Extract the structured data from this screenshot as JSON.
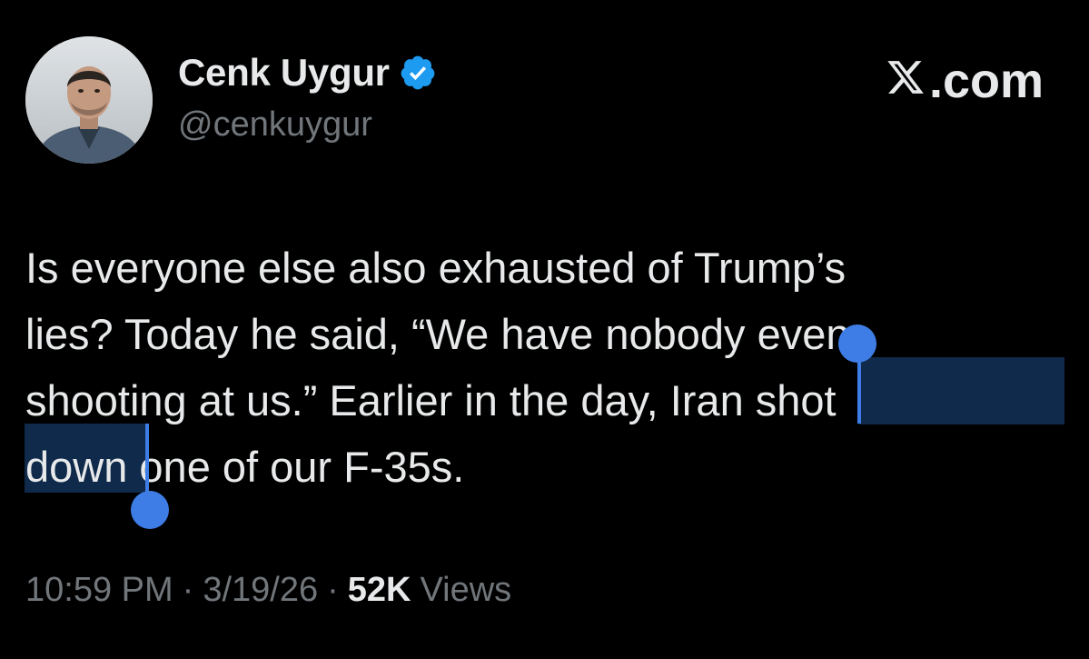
{
  "author": {
    "display_name": "Cenk Uygur",
    "handle": "@cenkuygur",
    "verified_icon": "verified-badge-icon",
    "avatar": "profile-photo"
  },
  "brand": {
    "logo_icon": "x-logo-icon",
    "suffix": ".com"
  },
  "tweet": {
    "lines": [
      "Is everyone else also exhausted of Trump’s",
      "lies? Today he said, “We have nobody even",
      "shooting at us.” Earlier in the day, Iran shot",
      "down one of our F-35s."
    ],
    "selected_text": "shot down"
  },
  "meta": {
    "time": "10:59 PM",
    "separator": "·",
    "date": "3/19/26",
    "views_count": "52K",
    "views_label": "Views"
  },
  "colors": {
    "background": "#000000",
    "text": "#e7e9ea",
    "secondary_text": "#71767b",
    "verified": "#1d9bf0",
    "selection": "#0f2a4a",
    "selection_handle": "#3e7de6"
  }
}
